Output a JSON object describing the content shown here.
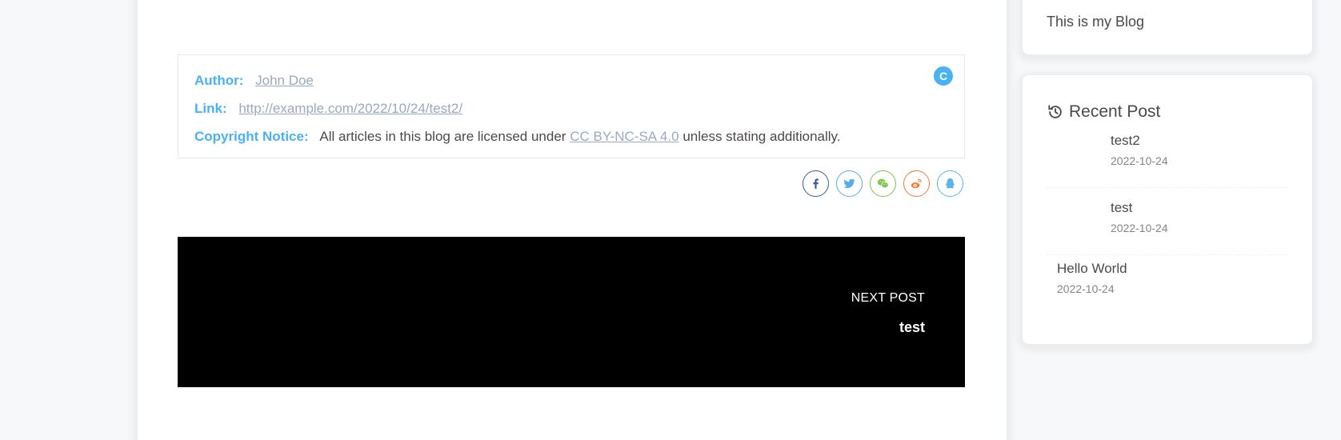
{
  "post": {
    "copyright": {
      "author_label": "Author:",
      "author_value": "John Doe",
      "link_label": "Link:",
      "link_value": "http://example.com/2022/10/24/test2/",
      "notice_label": "Copyright Notice:",
      "notice_prefix": "All articles in this blog are licensed under",
      "license_text": "CC BY-NC-SA 4.0",
      "notice_suffix": "unless stating additionally.",
      "badge_letter": "C"
    },
    "share": [
      {
        "icon": "facebook-icon",
        "color": "#3b5998"
      },
      {
        "icon": "twitter-icon",
        "color": "#55acee"
      },
      {
        "icon": "wechat-icon",
        "color": "#7bc549"
      },
      {
        "icon": "weibo-icon",
        "color": "#ff763b"
      },
      {
        "icon": "qq-icon",
        "color": "#56b6e7"
      }
    ],
    "pagination": {
      "label": "NEXT POST",
      "title": "test"
    }
  },
  "aside": {
    "description": "This is my Blog",
    "recent": {
      "title": "Recent Post",
      "items": [
        {
          "title": "test2",
          "date": "2022-10-24"
        },
        {
          "title": "test",
          "date": "2022-10-24"
        },
        {
          "title": "Hello World",
          "date": "2022-10-24"
        }
      ]
    }
  },
  "colors": {
    "accent": "#49b1f5",
    "link": "#99a9bf",
    "text": "#4c4948",
    "background": "#f6f8fa"
  }
}
